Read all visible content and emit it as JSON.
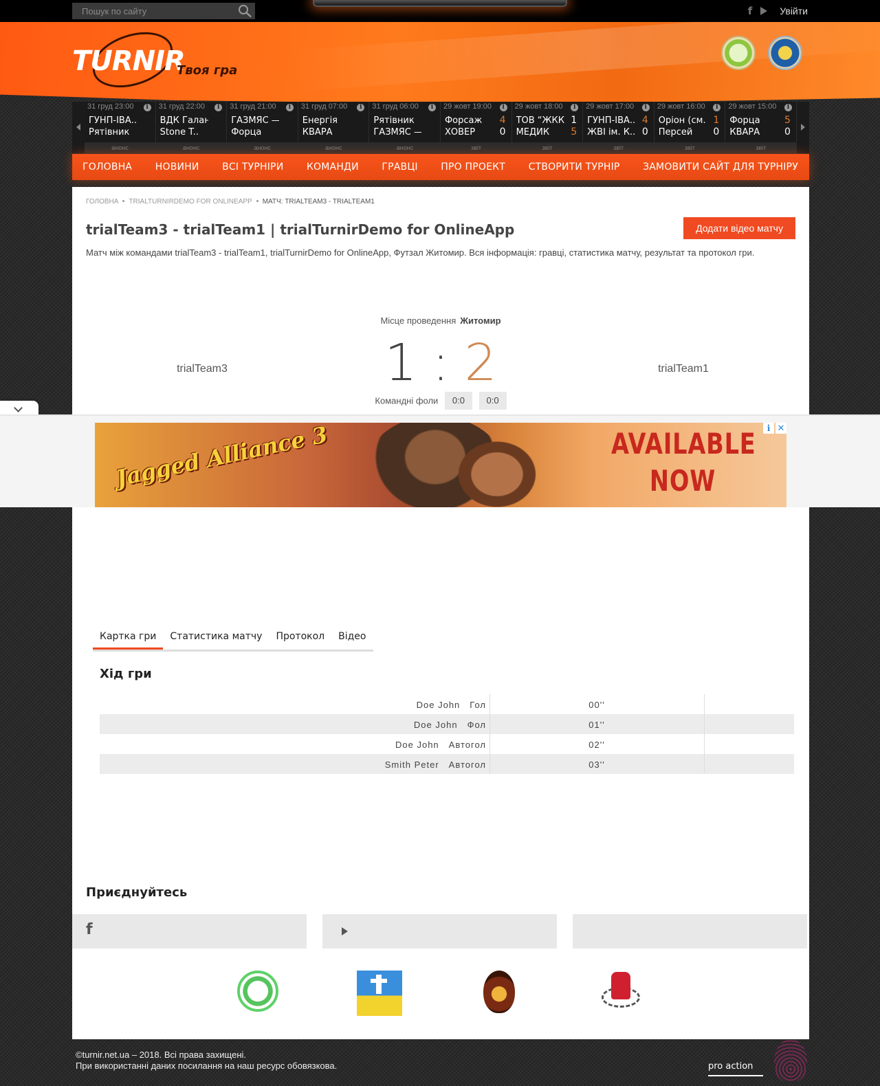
{
  "topbar": {
    "search_placeholder": "Пошук по сайту",
    "login_label": "Увійти",
    "social": [
      "facebook-icon",
      "youtube-icon"
    ]
  },
  "header": {
    "brand": "TURNIR",
    "tagline": "Твоя гра"
  },
  "ticker": [
    {
      "date": "31 груд 23:00",
      "team1": "ГУНП-ІВА..",
      "team2": "Рятівник",
      "score1": "",
      "score2": "",
      "status": "анонс"
    },
    {
      "date": "31 груд 22:00",
      "team1": "ВДК Галант",
      "team2": "Stone T..",
      "score1": "",
      "score2": "",
      "status": "анонс"
    },
    {
      "date": "31 груд 21:00",
      "team1": "ГАЗМЯС —",
      "team2": "Форца",
      "score1": "",
      "score2": "",
      "status": "анонс"
    },
    {
      "date": "31 груд 07:00",
      "team1": "Енергія",
      "team2": "КВАРА",
      "score1": "",
      "score2": "",
      "status": "анонс"
    },
    {
      "date": "31 груд 06:00",
      "team1": "Рятівник",
      "team2": "ГАЗМЯС —",
      "score1": "",
      "score2": "",
      "status": "анонс"
    },
    {
      "date": "29 жовт 19:00",
      "team1": "Форсаж",
      "team2": "ХОВЕР",
      "score1": "4",
      "score2": "0",
      "winner": 1,
      "status": "звіт"
    },
    {
      "date": "29 жовт 18:00",
      "team1": "ТОВ “ЖКК”",
      "team2": "МЕДИК",
      "score1": "1",
      "score2": "5",
      "winner": 2,
      "status": "звіт"
    },
    {
      "date": "29 жовт 17:00",
      "team1": "ГУНП-ІВА..",
      "team2": "ЖВІ ім. К..",
      "score1": "4",
      "score2": "0",
      "winner": 1,
      "status": "звіт"
    },
    {
      "date": "29 жовт 16:00",
      "team1": "Оріон (см..",
      "team2": "Персей",
      "score1": "1",
      "score2": "0",
      "winner": 1,
      "status": "звіт"
    },
    {
      "date": "29 жовт 15:00",
      "team1": "Форца",
      "team2": "КВАРА",
      "score1": "5",
      "score2": "0",
      "winner": 1,
      "status": "звіт"
    }
  ],
  "nav": [
    "Головна",
    "Новини",
    "Всі турніри",
    "Команди",
    "Гравці",
    "Про проект",
    "Створити турнір",
    "Замовити сайт для турніру"
  ],
  "breadcrumbs": [
    "Головна",
    "trialTurnirDemo for OnlineApp",
    "Матч: trialTeam3 - trialTeam1"
  ],
  "page": {
    "title": "trialTeam3 - trialTeam1 | trialTurnirDemo for OnlineApp",
    "video_button": "Додати відео матчу",
    "description": "Матч між командами trialTeam3 - trialTeam1, trialTurnirDemo for OnlineApp, Футзал Житомир. Вся інформація: гравці, статистика матчу, результат та протокол гри."
  },
  "match": {
    "venue_label": "Місце проведення",
    "venue": "Житомир",
    "home_team": "trialTeam3",
    "away_team": "trialTeam1",
    "home_score": "1",
    "separator": ":",
    "away_score": "2",
    "fouls_label": "Командні фоли",
    "fouls_home": "0:0",
    "fouls_away": "0:0"
  },
  "ad": {
    "game_title": "Jagged Alliance 3",
    "headline_line1": "AVAILABLE",
    "headline_line2": "NOW",
    "info_glyph": "i",
    "close_glyph": "✕"
  },
  "tabs": [
    "Картка гри",
    "Статистика матчу",
    "Протокол",
    "Відео"
  ],
  "game_flow": {
    "title": "Хід гри",
    "events": [
      {
        "player": "Doe John",
        "type": "Гол",
        "time": "00''"
      },
      {
        "player": "Doe John",
        "type": "Фол",
        "time": "01''"
      },
      {
        "player": "Doe John",
        "type": "Автогол",
        "time": "02''"
      },
      {
        "player": "Smith Peter",
        "type": "Автогол",
        "time": "03''"
      }
    ]
  },
  "join": {
    "title": "Приєднуйтесь"
  },
  "footer": {
    "line1": "©turnir.net.ua – 2018. Всі права захищені.",
    "line2": "При використанні даних посилання на наш ресурс обовязкова.",
    "partner_text": "pro action"
  }
}
